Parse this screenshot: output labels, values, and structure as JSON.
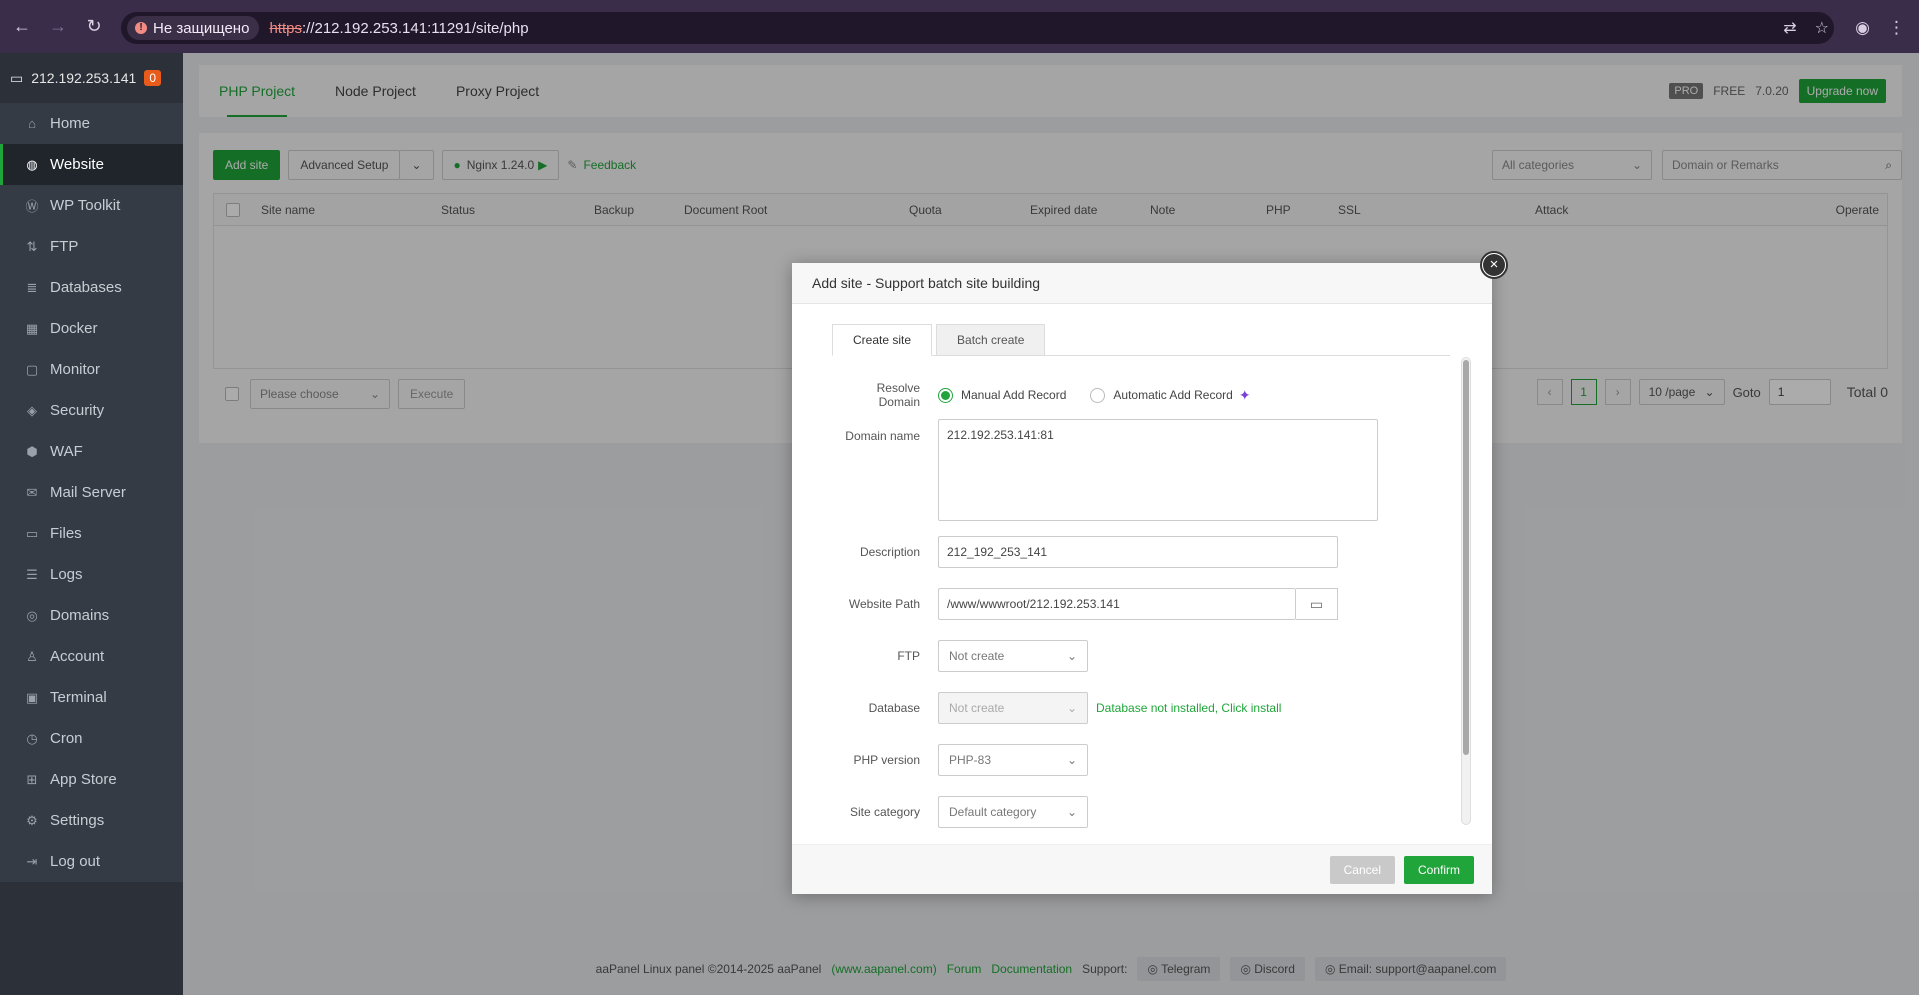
{
  "browser": {
    "insecure_label": "Не защищено",
    "url_scheme": "https",
    "url_rest": "://212.192.253.141:11291/site/php"
  },
  "sidebar": {
    "host": "212.192.253.141",
    "badge": "0",
    "items": [
      {
        "label": "Home",
        "icon": "home-icon"
      },
      {
        "label": "Website",
        "icon": "globe-icon",
        "active": true
      },
      {
        "label": "WP Toolkit",
        "icon": "wordpress-icon"
      },
      {
        "label": "FTP",
        "icon": "ftp-icon"
      },
      {
        "label": "Databases",
        "icon": "database-icon"
      },
      {
        "label": "Docker",
        "icon": "docker-icon"
      },
      {
        "label": "Monitor",
        "icon": "monitor-icon"
      },
      {
        "label": "Security",
        "icon": "shield-icon"
      },
      {
        "label": "WAF",
        "icon": "waf-icon"
      },
      {
        "label": "Mail Server",
        "icon": "mail-icon"
      },
      {
        "label": "Files",
        "icon": "folder-icon"
      },
      {
        "label": "Logs",
        "icon": "logs-icon"
      },
      {
        "label": "Domains",
        "icon": "domains-icon"
      },
      {
        "label": "Account",
        "icon": "user-icon"
      },
      {
        "label": "Terminal",
        "icon": "terminal-icon"
      },
      {
        "label": "Cron",
        "icon": "clock-icon"
      },
      {
        "label": "App Store",
        "icon": "grid-icon"
      },
      {
        "label": "Settings",
        "icon": "gear-icon"
      },
      {
        "label": "Log out",
        "icon": "logout-icon"
      }
    ]
  },
  "project_tabs": [
    "PHP Project",
    "Node Project",
    "Proxy Project"
  ],
  "top_right": {
    "pro": "PRO",
    "free": "FREE",
    "version": "7.0.20",
    "upgrade": "Upgrade now"
  },
  "toolbar": {
    "add_site": "Add site",
    "advanced_setup": "Advanced Setup",
    "nginx": "Nginx 1.24.0",
    "feedback": "Feedback",
    "category": "All categories",
    "search_placeholder": "Domain or Remarks"
  },
  "table": {
    "headers": [
      "Site name",
      "Status",
      "Backup",
      "Document Root",
      "Quota",
      "Expired date",
      "Note",
      "PHP",
      "SSL",
      "Attack",
      "Operate"
    ]
  },
  "batch": {
    "choose_placeholder": "Please choose",
    "execute": "Execute"
  },
  "pager": {
    "page": "1",
    "per_page": "10 /page",
    "goto": "Goto",
    "goto_value": "1",
    "total": "Total 0"
  },
  "footer": {
    "copyright": "aaPanel Linux panel ©2014-2025 aaPanel",
    "site_link": "(www.aapanel.com)",
    "forum": "Forum",
    "documentation": "Documentation",
    "support": "Support:",
    "telegram": "Telegram",
    "discord": "Discord",
    "email": "Email: support@aapanel.com"
  },
  "modal": {
    "title": "Add site - Support batch site building",
    "tabs": [
      "Create site",
      "Batch create"
    ],
    "resolve_label": "Resolve Domain",
    "manual": "Manual Add Record",
    "automatic": "Automatic Add Record",
    "domain_label": "Domain name",
    "domain_value": "212.192.253.141:81",
    "description_label": "Description",
    "description_value": "212_192_253_141",
    "path_label": "Website Path",
    "path_value": "/www/wwwroot/212.192.253.141",
    "ftp_label": "FTP",
    "ftp_value": "Not create",
    "database_label": "Database",
    "database_value": "Not create",
    "database_link": "Database not installed, Click install",
    "php_label": "PHP version",
    "php_value": "PHP-83",
    "category_label": "Site category",
    "category_value": "Default category",
    "cancel": "Cancel",
    "confirm": "Confirm"
  },
  "colors": {
    "accent": "#20a53a",
    "sidebar": "#2c3139"
  }
}
